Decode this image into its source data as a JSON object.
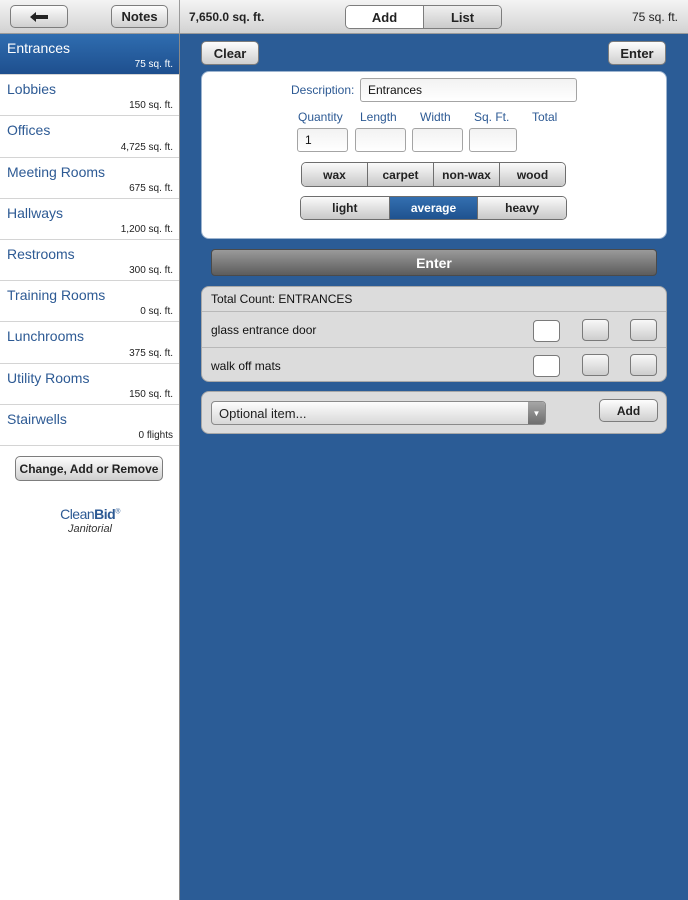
{
  "toolbar": {
    "back_icon": "left-arrow-icon",
    "notes_label": "Notes",
    "total_area": "7,650.0  sq. ft.",
    "segment": {
      "add_label": "Add",
      "list_label": "List",
      "selected": "Add"
    },
    "current_area": "75 sq. ft."
  },
  "sidebar": {
    "rooms": [
      {
        "name": "Entrances",
        "area": "75 sq. ft."
      },
      {
        "name": "Lobbies",
        "area": "150 sq. ft."
      },
      {
        "name": "Offices",
        "area": "4,725 sq. ft."
      },
      {
        "name": "Meeting Rooms",
        "area": "675 sq. ft."
      },
      {
        "name": "Hallways",
        "area": "1,200 sq. ft."
      },
      {
        "name": "Restrooms",
        "area": "300 sq. ft."
      },
      {
        "name": "Training Rooms",
        "area": "0 sq. ft."
      },
      {
        "name": "Lunchrooms",
        "area": "375 sq. ft."
      },
      {
        "name": "Utility Rooms",
        "area": "150 sq. ft."
      },
      {
        "name": "Stairwells",
        "area": "0 flights"
      }
    ],
    "selected_room": "Entrances",
    "change_button": "Change, Add or Remove",
    "logo": {
      "brand_light": "Clean",
      "brand_bold": "Bid",
      "registered": "®",
      "tagline": "Janitorial"
    }
  },
  "form": {
    "clear_label": "Clear",
    "enter_label": "Enter",
    "description_label": "Description:",
    "description_value": "Entrances",
    "quantity_label": "Quantity",
    "length_label": "Length",
    "width_label": "Width",
    "sqft_label": "Sq. Ft.",
    "total_label": "Total",
    "quantity_value": "1",
    "length_value": "",
    "width_value": "",
    "sqft_value": "",
    "floor_types": [
      "wax",
      "carpet",
      "non-wax",
      "wood"
    ],
    "traffic_levels": [
      "light",
      "average",
      "heavy"
    ],
    "selected_traffic": "average",
    "enter_bar_label": "Enter"
  },
  "counts": {
    "title": "Total Count: ENTRANCES",
    "items": [
      {
        "label": "glass entrance door"
      },
      {
        "label": "walk off mats"
      }
    ]
  },
  "optional": {
    "placeholder": "Optional item...",
    "add_label": "Add"
  },
  "colors": {
    "background_blue": "#2b5c96",
    "selected_blue": "#2f6db0",
    "label_blue": "#2d5a94"
  }
}
